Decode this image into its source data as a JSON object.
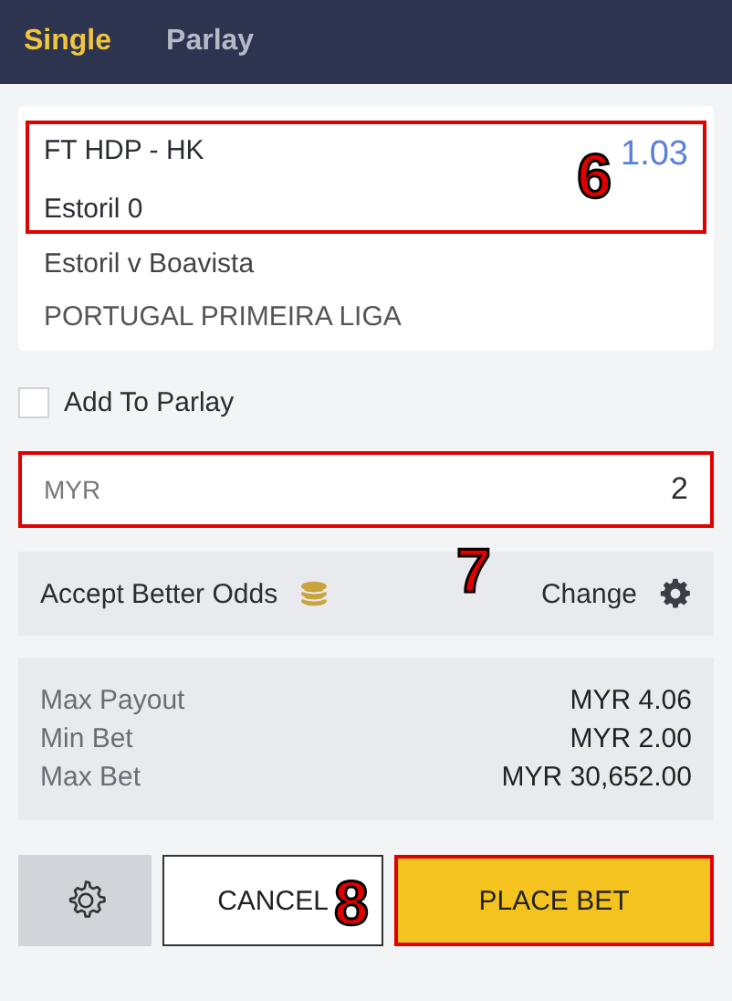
{
  "tabs": [
    {
      "label": "Single",
      "selected": true
    },
    {
      "label": "Parlay",
      "selected": false
    }
  ],
  "selection": {
    "market": "FT HDP - HK",
    "pick": "Estoril 0",
    "odds": "1.03",
    "callout": "6"
  },
  "match": "Estoril v Boavista",
  "league": "PORTUGAL PRIMEIRA LIGA",
  "add_to_parlay": {
    "label": "Add To Parlay",
    "checked": false
  },
  "stake": {
    "currency": "MYR",
    "value": "2",
    "callout": "7"
  },
  "accept_odds": {
    "label": "Accept Better Odds",
    "change": "Change"
  },
  "limits": [
    {
      "label": "Max Payout",
      "value": "MYR 4.06"
    },
    {
      "label": "Min Bet",
      "value": "MYR 2.00"
    },
    {
      "label": "Max Bet",
      "value": "MYR 30,652.00"
    }
  ],
  "buttons": {
    "cancel": "CANCEL",
    "place": "PLACE BET",
    "callout": "8"
  }
}
